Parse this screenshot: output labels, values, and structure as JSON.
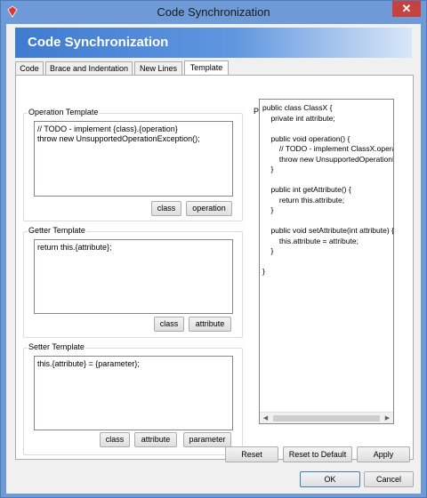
{
  "window": {
    "title": "Code Synchronization",
    "close_label": "✕"
  },
  "banner": {
    "title": "Code Synchronization"
  },
  "tabs": [
    {
      "label": "Code",
      "active": false
    },
    {
      "label": "Brace and Indentation",
      "active": false
    },
    {
      "label": "New Lines",
      "active": false
    },
    {
      "label": "Template",
      "active": true
    }
  ],
  "operation_template": {
    "label": "Operation Template",
    "value": "// TODO - implement {class}.{operation}\nthrow new UnsupportedOperationException();",
    "buttons": [
      "class",
      "operation"
    ]
  },
  "getter_template": {
    "label": "Getter Template",
    "value": "return this.{attribute};",
    "buttons": [
      "class",
      "attribute"
    ]
  },
  "setter_template": {
    "label": "Setter Template",
    "value": "this.{attribute} = {parameter};",
    "buttons": [
      "class",
      "attribute",
      "parameter"
    ]
  },
  "preview": {
    "label": "Preview",
    "code": "public class ClassX {\n    private int attribute;\n\n    public void operation() {\n        // TODO - implement ClassX.operation\n        throw new UnsupportedOperationException();\n    }\n\n    public int getAttribute() {\n        return this.attribute;\n    }\n\n    public void setAttribute(int attribute) {\n        this.attribute = attribute;\n    }\n\n}"
  },
  "footer": {
    "reset": "Reset",
    "reset_default": "Reset to Default",
    "apply": "Apply",
    "ok": "OK",
    "cancel": "Cancel"
  },
  "colors": {
    "titlebar": "#6f9ad8",
    "banner_start": "#3f7bd0",
    "close_button": "#c7423c"
  }
}
